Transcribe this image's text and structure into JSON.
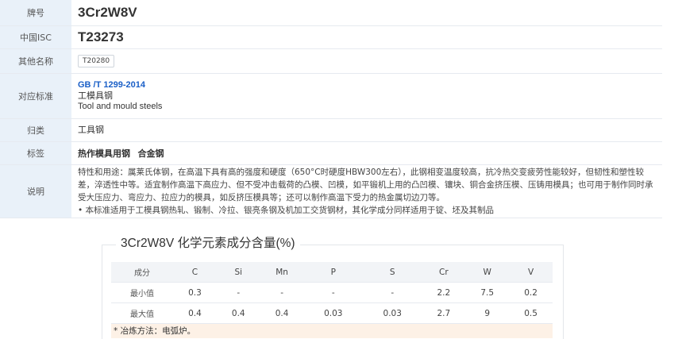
{
  "info": {
    "grade_label": "牌号",
    "grade_value": "3Cr2W8V",
    "china_isc_label": "中国ISC",
    "china_isc_value": "T23273",
    "other_names_label": "其他名称",
    "other_names_value": "T20280",
    "standard_label": "对应标准",
    "standard_code": "GB /T 1299-2014",
    "standard_cn": "工模具钢",
    "standard_en": "Tool and mould steels",
    "category_label": "归类",
    "category_value": "工具钢",
    "tags_label": "标签",
    "tags": [
      "热作模具用钢",
      "合金钢"
    ],
    "description_label": "说明",
    "description_1": "特性和用途：属莱氏体钢，在高温下具有高的强度和硬度（650°C时硬度HBW300左右），此钢相变温度较高，抗冷热交变疲劳性能较好，但韧性和塑性较差，淬透性中等。适宜制作高温下高应力、但不受冲击载荷的凸模、凹模，如平锻机上用的凸凹模、镶块、铜合金挤压模、压铸用模具；也可用于制作同时承受大压应力、弯应力、拉应力的模具，如反挤压模具等；还可以制作高温下受力的热金属切边刀等。",
    "description_2": "• 本标准适用于工模具钢热轧、锻制、冷拉、银亮条钢及机加工交货钢材，其化学成分同样适用于锭、坯及其制品"
  },
  "chemistry": {
    "title": "3Cr2W8V 化学元素成分含量(%)",
    "header_label": "成分",
    "elements": [
      "C",
      "Si",
      "Mn",
      "P",
      "S",
      "Cr",
      "W",
      "V"
    ],
    "rows": [
      {
        "label": "最小值",
        "values": [
          "0.3",
          "-",
          "-",
          "-",
          "-",
          "2.2",
          "7.5",
          "0.2"
        ]
      },
      {
        "label": "最大值",
        "values": [
          "0.4",
          "0.4",
          "0.4",
          "0.03",
          "0.03",
          "2.7",
          "9",
          "0.5"
        ]
      }
    ],
    "note": "* 冶炼方法：电弧炉。"
  }
}
